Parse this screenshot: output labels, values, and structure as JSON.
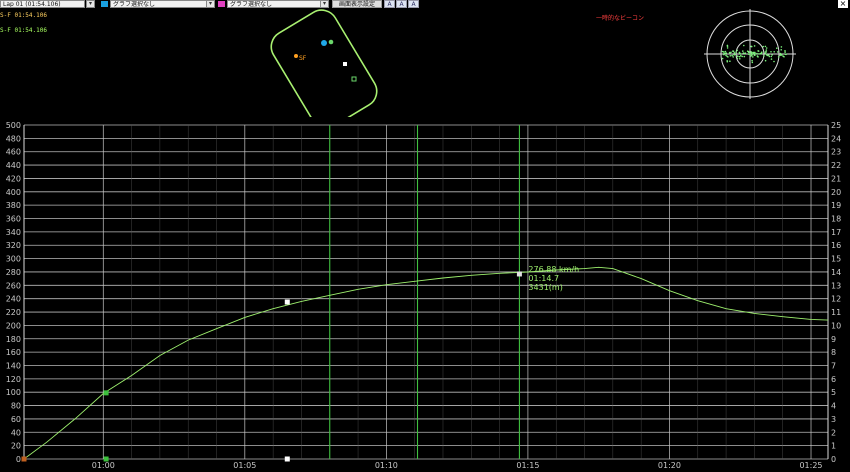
{
  "toolbar": {
    "lap_selector": "Lap 01  (01:54.106)",
    "graph_select_1": "グラフ選択なし",
    "graph_select_2": "グラフ選択なし",
    "display_settings": "画面表示設定",
    "font_a_small": "A",
    "font_a_medium": "A",
    "font_a_large": "A",
    "swatch_1_color": "#1aa0e0",
    "swatch_2_color": "#e040c0"
  },
  "map": {
    "laps": [
      {
        "label": "S-F",
        "time": "01:54.106",
        "color": "#ffd060"
      },
      {
        "label": "S-F",
        "time": "01:54.106",
        "color": "#a8ff60"
      }
    ],
    "start_finish_label": "SF",
    "beacon_label": "一時的なビーコン"
  },
  "chart_data": {
    "type": "line",
    "x_ticks": [
      "01:00",
      "01:05",
      "01:10",
      "01:15",
      "01:20",
      "01:25"
    ],
    "x_tick_seconds": [
      60,
      65,
      70,
      75,
      80,
      85
    ],
    "xlim": [
      57.2,
      85.6
    ],
    "y_left_ticks": [
      0,
      20,
      40,
      60,
      80,
      100,
      120,
      140,
      160,
      180,
      200,
      220,
      240,
      260,
      280,
      300,
      320,
      340,
      360,
      380,
      400,
      420,
      440,
      460,
      480,
      500
    ],
    "ylim_left": [
      0,
      500
    ],
    "y_right_ticks": [
      0,
      1,
      2,
      3,
      4,
      5,
      6,
      7,
      8,
      9,
      10,
      11,
      12,
      13,
      14,
      15,
      16,
      17,
      18,
      19,
      20,
      21,
      22,
      23,
      24,
      25
    ],
    "ylim_right": [
      0,
      25
    ],
    "series": [
      {
        "color": "#9ef06e",
        "x": [
          57.2,
          58,
          59,
          60,
          61,
          62,
          63,
          64,
          65,
          66,
          67,
          68,
          69,
          70,
          71,
          72,
          73,
          74,
          75,
          76,
          77,
          77.5,
          78,
          79,
          80,
          81,
          82,
          83,
          84,
          85,
          85.6
        ],
        "y": [
          0,
          25,
          60,
          98,
          125,
          155,
          178,
          195,
          212,
          225,
          236,
          245,
          254,
          261,
          266,
          271,
          275,
          278,
          280,
          283,
          285,
          287,
          285,
          270,
          252,
          237,
          225,
          218,
          213,
          209,
          208
        ]
      }
    ],
    "cursor_lines_seconds": [
      68.0,
      71.1,
      74.7
    ],
    "markers": [
      {
        "x": 57.2,
        "y": 0,
        "color": "#c06020"
      },
      {
        "x": 60.1,
        "y": 99,
        "color": "#3cc03c"
      },
      {
        "x": 60.1,
        "y": 0,
        "color": "#3cc03c"
      },
      {
        "x": 66.5,
        "y": 235,
        "color": "#ffffff"
      },
      {
        "x": 66.5,
        "y": 0,
        "color": "#ffffff"
      },
      {
        "x": 74.7,
        "y": 277,
        "color": "#e0e0e0"
      }
    ],
    "readout": {
      "speed": "276.88 km/h",
      "time": "01:14.7",
      "distance": "3431(m)"
    }
  }
}
